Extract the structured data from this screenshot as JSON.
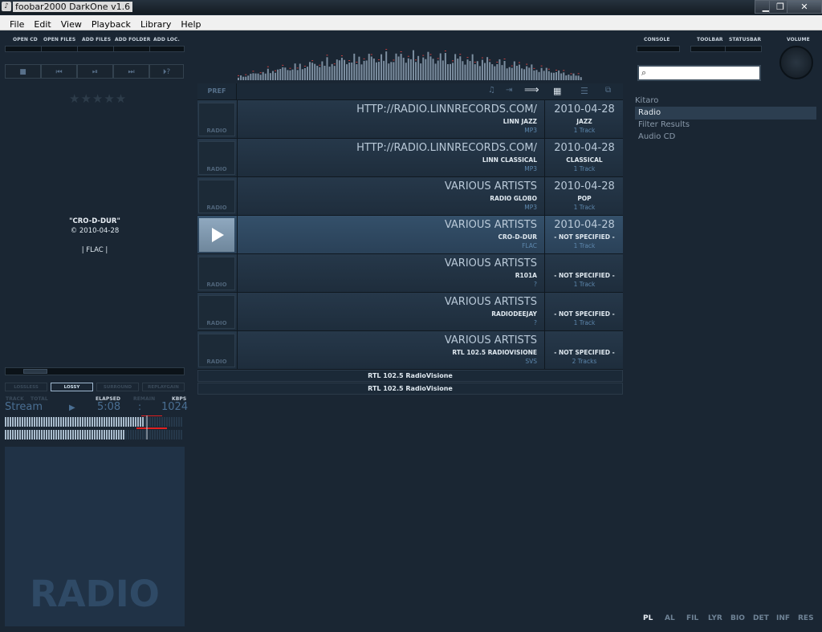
{
  "window": {
    "title": "foobar2000 DarkOne v1.6",
    "minimize": "▁",
    "restore": "❐",
    "close": "✕"
  },
  "menu": [
    "File",
    "Edit",
    "View",
    "Playback",
    "Library",
    "Help"
  ],
  "top_buttons": [
    "OPEN CD",
    "OPEN FILES",
    "ADD FILES",
    "ADD FOLDER",
    "ADD LOC."
  ],
  "right_buttons": [
    "CONSOLE",
    "TOOLBAR",
    "STATUSBAR",
    "VOLUME"
  ],
  "transport": [
    "■",
    "⏮",
    "⏯",
    "⏭",
    "⏵?"
  ],
  "rating": "★★★★★",
  "now_playing": {
    "title": "\"CRO-D-DUR\"",
    "date": "© 2010-04-28",
    "format": "| FLAC |"
  },
  "playlist_header": {
    "pref": "PREF",
    "icons": [
      "music-note-icon",
      "import-icon",
      "arrow-right-icon",
      "grid-view-icon",
      "list-view-icon",
      "window-icon"
    ]
  },
  "rows": [
    {
      "artist": "HTTP://RADIO.LINNRECORDS.COM/",
      "album": "LINN JAZZ",
      "codec": "MP3",
      "date": "2010-04-28",
      "genre": "JAZZ",
      "tracks": "1 Track",
      "thumb": "RADIO",
      "active": false
    },
    {
      "artist": "HTTP://RADIO.LINNRECORDS.COM/",
      "album": "LINN CLASSICAL",
      "codec": "MP3",
      "date": "2010-04-28",
      "genre": "CLASSICAL",
      "tracks": "1 Track",
      "thumb": "RADIO",
      "active": false
    },
    {
      "artist": "VARIOUS ARTISTS",
      "album": "RADIO GLOBO",
      "codec": "MP3",
      "date": "2010-04-28",
      "genre": "POP",
      "tracks": "1 Track",
      "thumb": "RADIO",
      "active": false
    },
    {
      "artist": "VARIOUS ARTISTS",
      "album": "CRO-D-DUR",
      "codec": "FLAC",
      "date": "2010-04-28",
      "genre": "- NOT SPECIFIED -",
      "tracks": "1 Track",
      "thumb": "",
      "active": true
    },
    {
      "artist": "VARIOUS ARTISTS",
      "album": "R101A",
      "codec": "?",
      "date": "",
      "genre": "- NOT SPECIFIED -",
      "tracks": "1 Track",
      "thumb": "RADIO",
      "active": false
    },
    {
      "artist": "VARIOUS ARTISTS",
      "album": "RADIODEEJAY",
      "codec": "?",
      "date": "",
      "genre": "- NOT SPECIFIED -",
      "tracks": "1 Track",
      "thumb": "RADIO",
      "active": false
    },
    {
      "artist": "VARIOUS ARTISTS",
      "album": "RTL 102.5 RADIOVISIONE",
      "codec": "SVS",
      "date": "",
      "genre": "- NOT SPECIFIED -",
      "tracks": "2 Tracks",
      "thumb": "RADIO",
      "active": false
    }
  ],
  "footer_rows": [
    "RTL 102.5 RadioVisione",
    "RTL 102.5 RadioVisione"
  ],
  "tree": [
    {
      "label": "Kitaro",
      "selected": false
    },
    {
      "label": "Radio",
      "selected": true
    },
    {
      "label": "Filter Results",
      "selected": false
    },
    {
      "label": "Audio CD",
      "selected": false
    }
  ],
  "modes": [
    {
      "label": "LOSSLESS",
      "on": false
    },
    {
      "label": "LOSSY",
      "on": true
    },
    {
      "label": "SURROUND",
      "on": false
    },
    {
      "label": "REPLAYGAIN",
      "on": false
    }
  ],
  "status": {
    "track_label": "TRACK",
    "total_label": "TOTAL",
    "elapsed_label": "ELAPSED",
    "remain_label": "REMAIN",
    "kbps_label": "KBPS",
    "stream": "Stream",
    "elapsed": "5:08",
    "colon": ":",
    "kbps": "1024"
  },
  "album_art_text": "RADIO",
  "bottom_tabs": [
    "PL",
    "AL",
    "FIL",
    "LYR",
    "BIO",
    "DET",
    "INF",
    "RES"
  ],
  "active_tab": "PL",
  "colors": {
    "accent": "#2c4157",
    "selected_tree": "#2c3e50",
    "meter_red": "#e02020"
  }
}
